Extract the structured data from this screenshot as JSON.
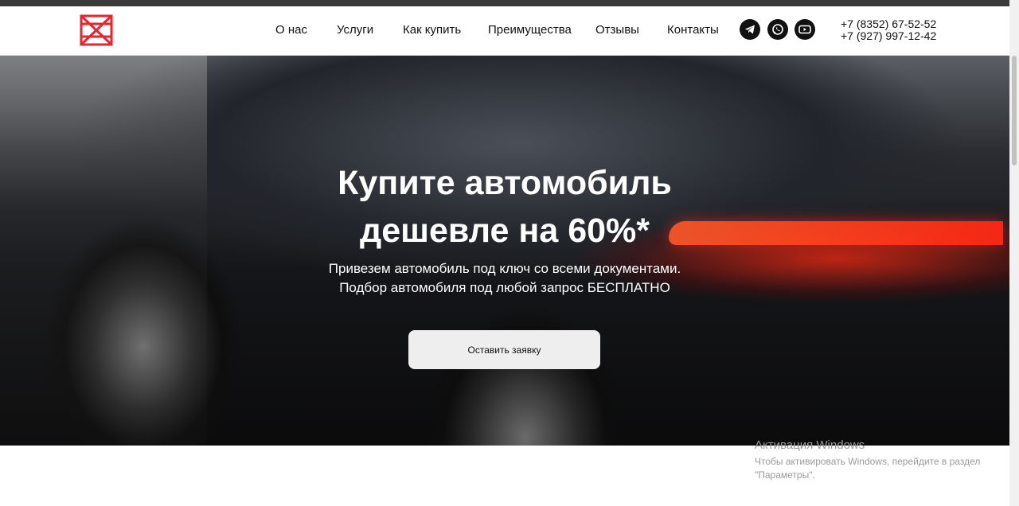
{
  "header": {
    "nav": [
      {
        "label": "О нас"
      },
      {
        "label": "Услуги"
      },
      {
        "label": "Как купить"
      },
      {
        "label": "Преимущества"
      },
      {
        "label": "Отзывы"
      },
      {
        "label": "Контакты"
      }
    ],
    "social": [
      {
        "icon": "telegram-icon"
      },
      {
        "icon": "whatsapp-icon"
      },
      {
        "icon": "youtube-icon"
      }
    ],
    "phones": [
      "+7 (8352) 67-52-52",
      "+7 (927) 997-12-42"
    ]
  },
  "hero": {
    "title_line1": "Купите автомобиль",
    "title_line2": "дешевле на 60%*",
    "subtitle_line1": "Привезем автомобиль под ключ со всеми документами.",
    "subtitle_line2": "Подбор автомобиля под любой запрос БЕСПЛАТНО",
    "cta_label": "Оставить заявку"
  },
  "windows_activation": {
    "title": "Активация Windows",
    "text": "Чтобы активировать Windows, перейдите в раздел \"Параметры\"."
  },
  "colors": {
    "brand_red": "#e3262f",
    "header_bg": "#ffffff",
    "button_bg": "#eeeeee"
  }
}
